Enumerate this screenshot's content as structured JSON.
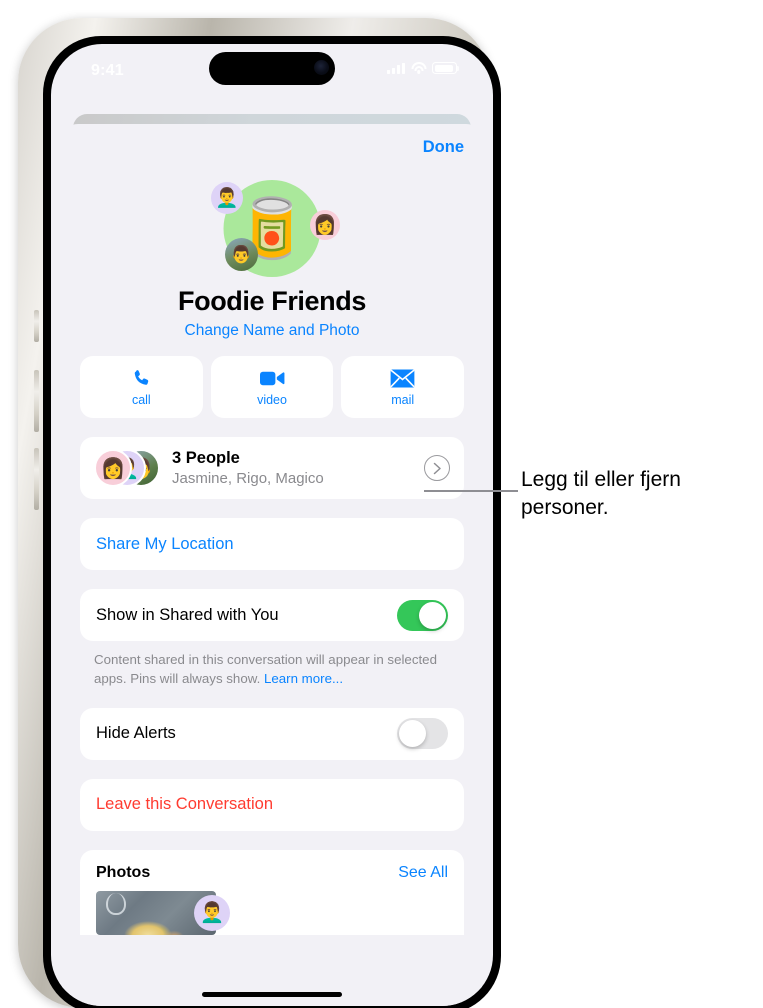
{
  "status_bar": {
    "time": "9:41",
    "signal_icon": "cellular-bars-icon",
    "wifi_icon": "wifi-icon",
    "battery_icon": "battery-icon"
  },
  "sheet": {
    "done_label": "Done",
    "group": {
      "icon_glyph": "🥫",
      "icon_name": "canned-food-emoji",
      "title": "Foodie Friends",
      "change_link": "Change Name and Photo",
      "mini_avatars": [
        {
          "name": "memoji-avatar-lavender",
          "glyph": "👨‍🦱"
        },
        {
          "name": "memoji-avatar-pink",
          "glyph": "👩"
        },
        {
          "name": "photo-avatar-green",
          "glyph": "👨"
        }
      ]
    },
    "actions": [
      {
        "name": "call-button",
        "icon": "phone-icon",
        "label": "call"
      },
      {
        "name": "video-button",
        "icon": "video-camera-icon",
        "label": "video"
      },
      {
        "name": "mail-button",
        "icon": "envelope-icon",
        "label": "mail"
      }
    ],
    "people_row": {
      "title": "3 People",
      "subtitle": "Jasmine, Rigo, Magico",
      "chevron_icon": "chevron-right-icon",
      "avatars": [
        {
          "name": "avatar-jasmine",
          "glyph": "👩"
        },
        {
          "name": "avatar-rigo",
          "glyph": "👨‍🦱"
        },
        {
          "name": "avatar-magico",
          "glyph": "👨"
        }
      ]
    },
    "share_location": {
      "label": "Share My Location"
    },
    "shared_with_you": {
      "label": "Show in Shared with You",
      "toggle_state": "on"
    },
    "footnote": {
      "text": "Content shared in this conversation will appear in selected apps. Pins will always show. ",
      "link": "Learn more..."
    },
    "hide_alerts": {
      "label": "Hide Alerts",
      "toggle_state": "off"
    },
    "leave": {
      "label": "Leave this Conversation"
    },
    "photos": {
      "title": "Photos",
      "see_all": "See All",
      "thumbnail_name": "photo-thumbnail-food",
      "thumbnail_avatar_glyph": "👨‍🦱"
    }
  },
  "callout": {
    "text": "Legg til eller fjern personer."
  },
  "colors": {
    "accent_blue": "#0a84ff",
    "destructive_red": "#ff3b30",
    "toggle_on_green": "#34c759",
    "group_circle_green": "#aae89b",
    "sheet_background": "#f2f1f6",
    "card_white": "#ffffff",
    "secondary_text": "#8a8a8e"
  }
}
